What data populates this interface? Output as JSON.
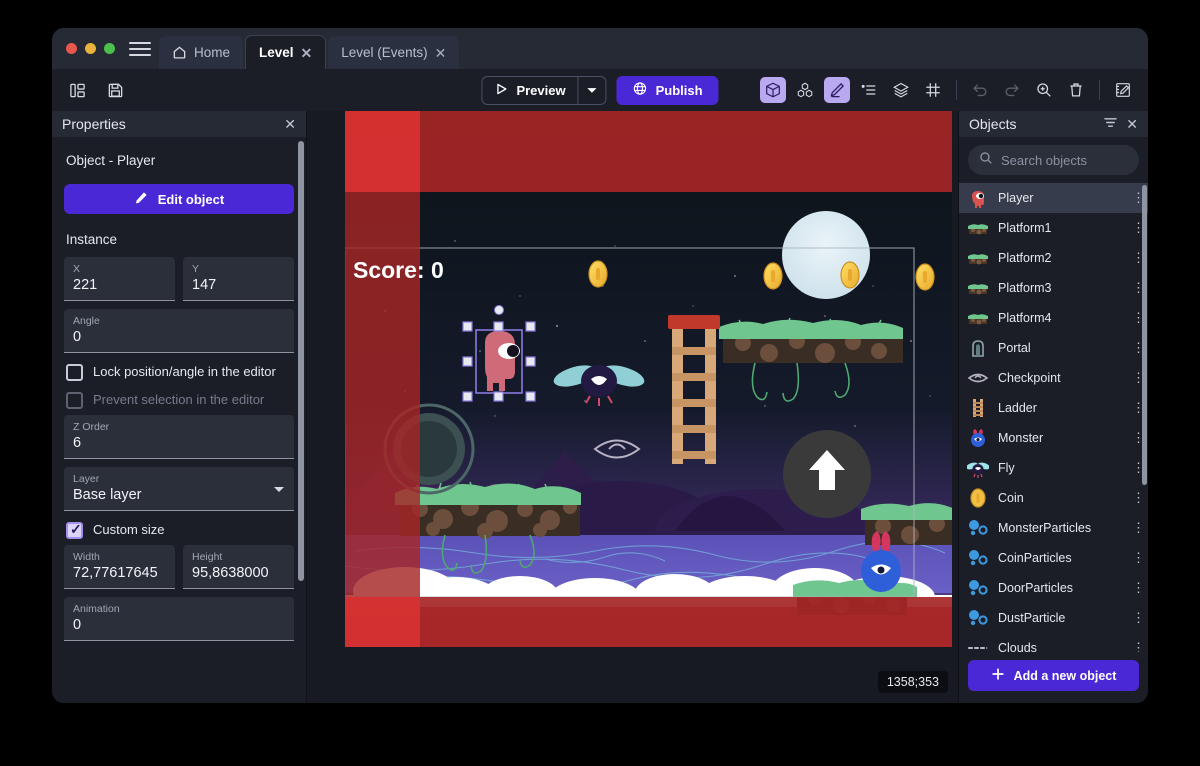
{
  "window": {
    "traffic_lights": [
      "close",
      "minimize",
      "maximize"
    ],
    "menu_icon": "hamburger-icon"
  },
  "tabs": [
    {
      "label": "Home",
      "icon": "home-icon",
      "active": false,
      "closable": false
    },
    {
      "label": "Level",
      "icon": null,
      "active": true,
      "closable": true
    },
    {
      "label": "Level (Events)",
      "icon": null,
      "active": false,
      "closable": true
    }
  ],
  "toolbar": {
    "left_icons": [
      "panel-layout-icon",
      "save-icon"
    ],
    "preview_label": "Preview",
    "preview_icon": "play-icon",
    "preview_dropdown_icon": "chevron-down-icon",
    "publish_label": "Publish",
    "publish_icon": "globe-icon",
    "right_icons": [
      {
        "name": "cube-3d-icon",
        "active": true
      },
      {
        "name": "objects-blocks-icon",
        "active": false
      },
      {
        "name": "pencil-edit-icon",
        "active": true
      },
      {
        "name": "instances-list-icon",
        "active": false
      },
      {
        "name": "layers-icon",
        "active": false
      },
      {
        "name": "grid-icon",
        "active": false
      },
      {
        "name": "undo-icon",
        "active": false,
        "disabled": true
      },
      {
        "name": "redo-icon",
        "active": false,
        "disabled": true
      },
      {
        "name": "zoom-icon",
        "active": false
      },
      {
        "name": "trash-icon",
        "active": false
      },
      {
        "name": "edit-scene-icon",
        "active": false
      }
    ]
  },
  "properties": {
    "title": "Properties",
    "close_icon": "close-icon",
    "object_line": "Object  - Player",
    "edit_button": "Edit object",
    "edit_button_icon": "pencil-icon",
    "instance_label": "Instance",
    "fields": {
      "x": {
        "label": "X",
        "value": "221"
      },
      "y": {
        "label": "Y",
        "value": "147"
      },
      "angle": {
        "label": "Angle",
        "value": "0"
      },
      "z_order": {
        "label": "Z Order",
        "value": "6"
      },
      "layer": {
        "label": "Layer",
        "value": "Base layer"
      },
      "width": {
        "label": "Width",
        "value": "72,77617645"
      },
      "height": {
        "label": "Height",
        "value": "95,8638000"
      },
      "animation": {
        "label": "Animation",
        "value": "0"
      }
    },
    "checkboxes": {
      "lock": {
        "label": "Lock position/angle in the editor",
        "checked": false,
        "disabled": false
      },
      "prevent": {
        "label": "Prevent selection in the editor",
        "checked": false,
        "disabled": true
      },
      "custom_size": {
        "label": "Custom size",
        "checked": true,
        "disabled": false
      }
    }
  },
  "objects_panel": {
    "title": "Objects",
    "filter_icon": "filter-icon",
    "close_icon": "close-icon",
    "search_placeholder": "Search objects",
    "search_value": "",
    "search_icon": "search-icon",
    "add_button": "Add a new object",
    "add_icon": "plus-icon",
    "items": [
      {
        "name": "Player",
        "icon": "player-thumb",
        "selected": true
      },
      {
        "name": "Platform1",
        "icon": "platform-thumb",
        "selected": false
      },
      {
        "name": "Platform2",
        "icon": "platform-thumb",
        "selected": false
      },
      {
        "name": "Platform3",
        "icon": "platform-thumb",
        "selected": false
      },
      {
        "name": "Platform4",
        "icon": "platform-thumb",
        "selected": false
      },
      {
        "name": "Portal",
        "icon": "portal-thumb",
        "selected": false
      },
      {
        "name": "Checkpoint",
        "icon": "checkpoint-thumb",
        "selected": false
      },
      {
        "name": "Ladder",
        "icon": "ladder-thumb",
        "selected": false
      },
      {
        "name": "Monster",
        "icon": "monster-thumb",
        "selected": false
      },
      {
        "name": "Fly",
        "icon": "fly-thumb",
        "selected": false
      },
      {
        "name": "Coin",
        "icon": "coin-thumb",
        "selected": false
      },
      {
        "name": "MonsterParticles",
        "icon": "particles-thumb",
        "selected": false
      },
      {
        "name": "CoinParticles",
        "icon": "particles-thumb",
        "selected": false
      },
      {
        "name": "DoorParticles",
        "icon": "particles-thumb",
        "selected": false
      },
      {
        "name": "DustParticle",
        "icon": "particles-thumb",
        "selected": false
      },
      {
        "name": "Clouds",
        "icon": "clouds-thumb",
        "selected": false
      }
    ],
    "row_menu_icon": "kebab-menu-icon"
  },
  "canvas": {
    "score_text": "Score: 0",
    "coordinates": "1358;353",
    "selected_object": "Player"
  },
  "colors": {
    "accent": "#4b28d6",
    "panel_bg": "#1b1e27",
    "panel_head_bg": "#252a35",
    "field_bg": "#2b2f3a",
    "text": "#e6e8ee",
    "muted": "#a0a6b4",
    "selection": "#8a7ae0",
    "overlay_red": "#a62626",
    "overlay_red_light": "#d83232",
    "sky": "#0d1418"
  }
}
